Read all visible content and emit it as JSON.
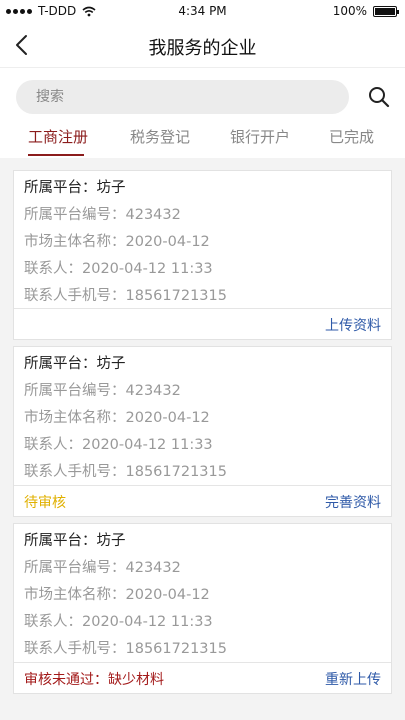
{
  "status_bar": {
    "carrier": "T-DDD",
    "time": "4:34 PM",
    "battery": "100%"
  },
  "nav": {
    "title": "我服务的企业"
  },
  "search": {
    "placeholder": "搜索",
    "value": ""
  },
  "tabs": [
    {
      "label": "工商注册",
      "active": true
    },
    {
      "label": "税务登记",
      "active": false
    },
    {
      "label": "银行开户",
      "active": false
    },
    {
      "label": "已完成",
      "active": false
    }
  ],
  "cards": [
    {
      "platform": "所属平台：坊子",
      "platform_no": "所属平台编号：423432",
      "entity_name": "市场主体名称：2020-04-12",
      "contact": "联系人：2020-04-12 11:33",
      "contact_phone": "联系人手机号：18561721315",
      "status": "",
      "action": "上传资料"
    },
    {
      "platform": "所属平台：坊子",
      "platform_no": "所属平台编号：423432",
      "entity_name": "市场主体名称：2020-04-12",
      "contact": "联系人：2020-04-12 11:33",
      "contact_phone": "联系人手机号：18561721315",
      "status": "待审核",
      "action": "完善资料"
    },
    {
      "platform": "所属平台：坊子",
      "platform_no": "所属平台编号：423432",
      "entity_name": "市场主体名称：2020-04-12",
      "contact": "联系人：2020-04-12 11:33",
      "contact_phone": "联系人手机号：18561721315",
      "status": "审核未通过：缺少材料",
      "action": "重新上传"
    }
  ],
  "colors": {
    "accent": "#8b1c1c",
    "link": "#2f5aa8",
    "pending": "#e0b000",
    "rejected": "#a31a1a"
  }
}
